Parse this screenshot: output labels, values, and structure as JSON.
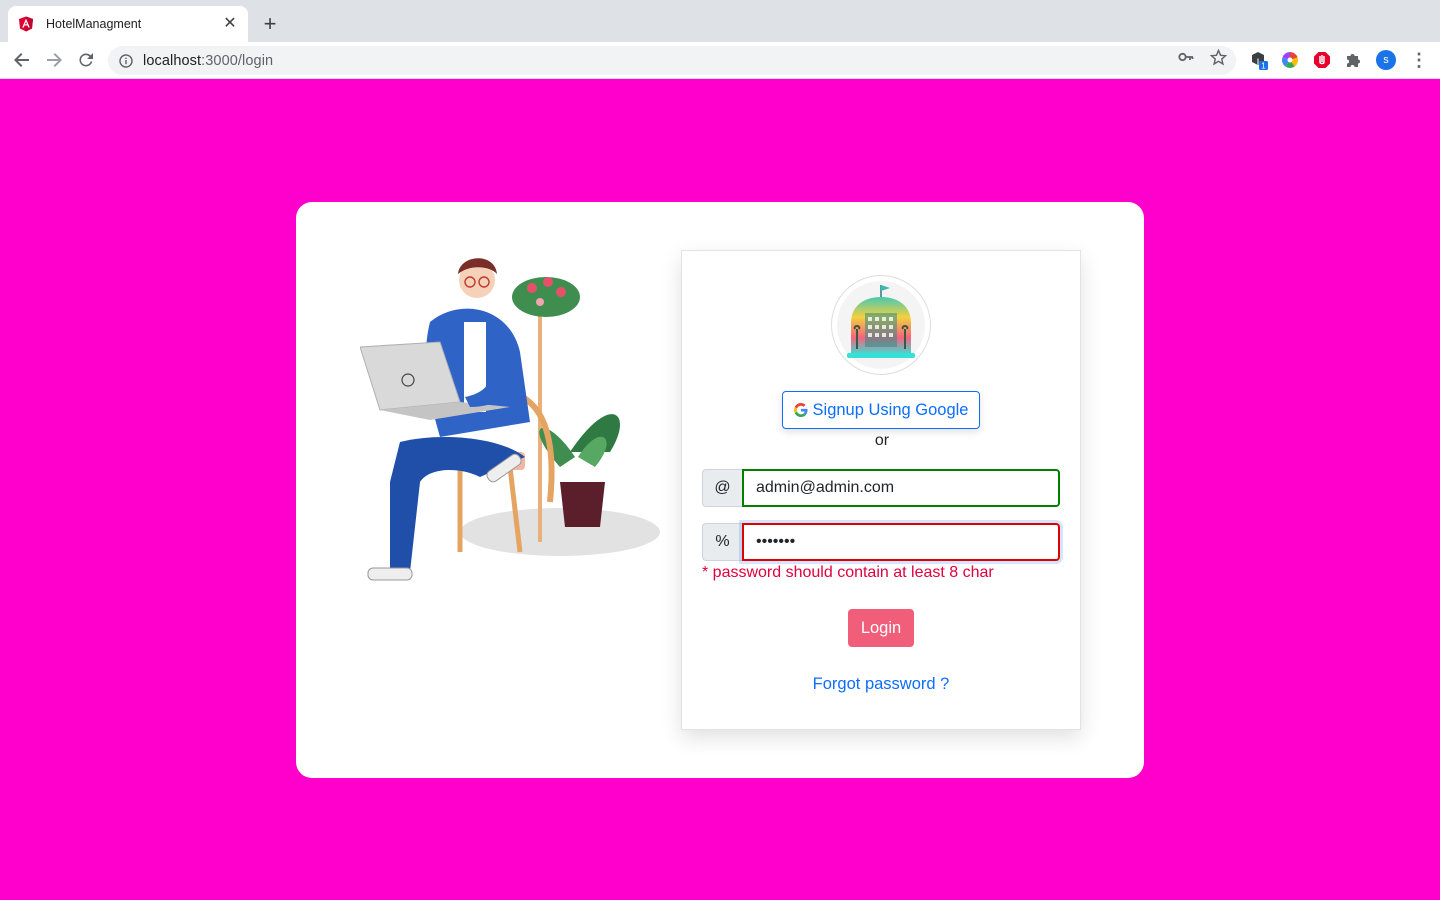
{
  "browser": {
    "tab_title": "HotelManagment",
    "url_host": "localhost",
    "url_path": ":3000/login",
    "profile_initial": "s",
    "extension_badge": "1"
  },
  "login": {
    "google_button_label": "Signup Using Google",
    "separator_text": "or",
    "email_prefix": "@",
    "email_value": "admin@admin.com",
    "password_prefix": "%",
    "password_value": "1234567",
    "password_error": "* password should contain at least 8 char",
    "login_label": "Login",
    "forgot_label": "Forgot password ?"
  },
  "colors": {
    "page_background": "#ff00cc",
    "link_blue": "#0d6efd",
    "login_button": "#f05e7a",
    "valid_border": "#008000",
    "invalid_border": "#e00000"
  },
  "icons": [
    "angular-icon",
    "close-icon",
    "plus-icon",
    "back-arrow-icon",
    "forward-arrow-icon",
    "reload-icon",
    "info-icon",
    "key-icon",
    "star-icon",
    "google-icon"
  ]
}
